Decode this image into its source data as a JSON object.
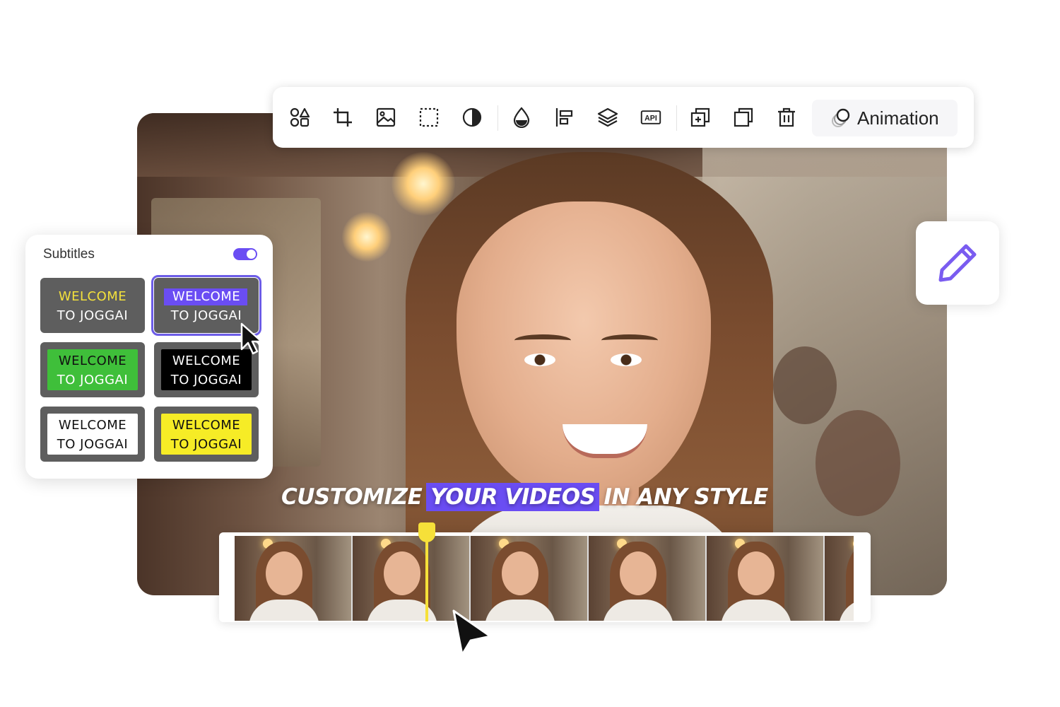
{
  "toolbar": {
    "tools": [
      {
        "icon": "shape-icon"
      },
      {
        "icon": "crop-icon"
      },
      {
        "icon": "image-icon"
      },
      {
        "icon": "dashed-select-icon"
      },
      {
        "icon": "contrast-icon"
      },
      {
        "icon": "opacity-drop-icon"
      },
      {
        "icon": "align-left-icon"
      },
      {
        "icon": "layers-icon"
      },
      {
        "icon": "api-icon"
      },
      {
        "icon": "duplicate-add-icon"
      },
      {
        "icon": "copy-icon"
      },
      {
        "icon": "delete-icon"
      }
    ],
    "api_badge": "API",
    "animation_label": "Animation"
  },
  "subtitles": {
    "title": "Subtitles",
    "enabled": true,
    "accent": "#6a4df3",
    "styles": [
      {
        "line1": "WELCOME",
        "line2": "TO JOGGAI"
      },
      {
        "line1": "WELCOME",
        "line2": "TO JOGGAI"
      },
      {
        "line1": "WELCOME",
        "line2": "TO JOGGAI"
      },
      {
        "line1": "WELCOME",
        "line2": "TO JOGGAI"
      },
      {
        "line1": "WELCOME",
        "line2": "TO JOGGAI"
      },
      {
        "line1": "WELCOME",
        "line2": "TO JOGGAI"
      }
    ]
  },
  "caption": {
    "before": "CUSTOMIZE",
    "highlight": "YOUR VIDEOS",
    "after": "IN ANY STYLE",
    "highlight_color": "#6a4df3"
  },
  "timeline": {
    "frame_count": 6,
    "playhead_color": "#f6e039"
  }
}
